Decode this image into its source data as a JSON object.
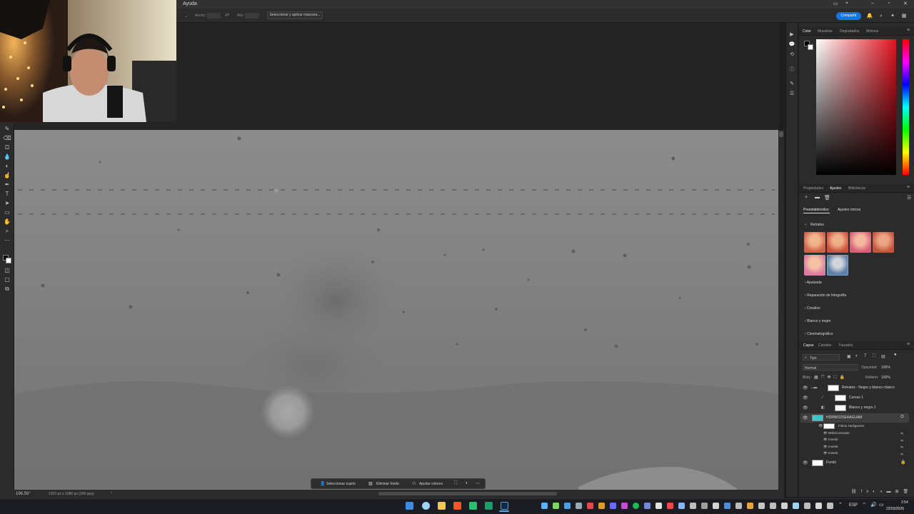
{
  "menubar": {
    "help_label": "Ayuda"
  },
  "options_bar": {
    "width_label": "Ancho",
    "height_label": "Alto",
    "mask_button": "Seleccionar y aplicar máscara...",
    "share_button": "Compartir"
  },
  "color_panel": {
    "tabs": [
      "Color",
      "Muestras",
      "Degradados",
      "Motivos"
    ],
    "active_tab": "Color",
    "colors": {
      "foreground": "#000000",
      "background": "#ffffff",
      "field_hue": "#e3121f"
    }
  },
  "adjustments_panel": {
    "tabs": [
      "Propiedades",
      "Ajustes",
      "Bibliotecas"
    ],
    "active_tab": "Ajustes",
    "subtabs": [
      "Preestablecidos",
      "Ajustes únicos"
    ],
    "section_title": "Retratos",
    "categories": [
      "Apaisada",
      "Reparación de fotografía",
      "Creativo",
      "Blanco y negro",
      "Cinematográfico"
    ]
  },
  "layers_panel": {
    "tabs": [
      "Capas",
      "Canales",
      "Trazados"
    ],
    "active_tab": "Capas",
    "filter_kind": "Tipo",
    "blend_mode": "Normal",
    "opacity_label": "Opacidad:",
    "opacity_value": "100%",
    "lock_label": "Bloq.:",
    "fill_label": "Relleno:",
    "fill_value": "100%",
    "layers": [
      {
        "name": "Retratos - Negro y blanco clásico",
        "type": "group"
      },
      {
        "name": "Curvas 1",
        "type": "adjustment"
      },
      {
        "name": "Blanco y negro 1",
        "type": "adjustment"
      },
      {
        "name": "HDRWO2SEAAGUAM",
        "type": "smart-object"
      },
      {
        "name": "Fondo",
        "type": "background"
      }
    ],
    "smart_filters_label": "Filtros inteligentes",
    "smart_filters": [
      "Brillo/contraste",
      "Invertir",
      "Invertir",
      "Invertir"
    ]
  },
  "status_bar": {
    "zoom": "196.56°",
    "doc_info": "1920 px x 1080 px (300 ppp)"
  },
  "context_bar": {
    "select_subject": "Seleccionar sujeto",
    "remove_bg": "Eliminar fondo",
    "adjust_colors": "Ajustar colores"
  },
  "taskbar": {
    "language": "ESP",
    "time": "2:54",
    "date": "22/03/2026"
  }
}
